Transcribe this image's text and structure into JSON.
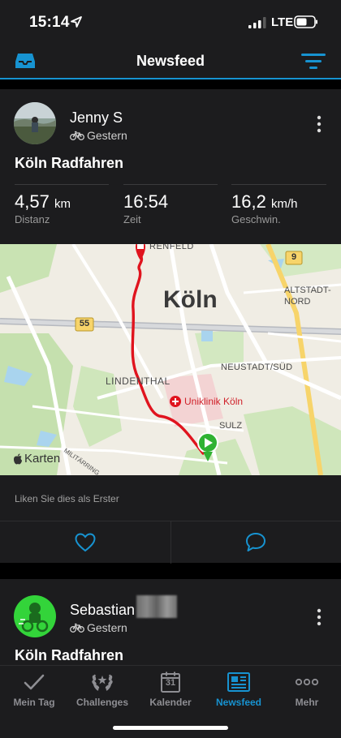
{
  "status": {
    "time": "15:14",
    "network": "LTE"
  },
  "header": {
    "title": "Newsfeed"
  },
  "posts": [
    {
      "user": "Jenny S",
      "when": "Gestern",
      "title": "Köln Radfahren",
      "stats": [
        {
          "value": "4,57",
          "unit": "km",
          "label": "Distanz"
        },
        {
          "value": "16:54",
          "unit": "",
          "label": "Zeit"
        },
        {
          "value": "16,2",
          "unit": "km/h",
          "label": "Geschwin."
        }
      ],
      "map": {
        "city": "Köln",
        "labels": [
          "RENFELD",
          "ALTSTADT-NORD",
          "NEUSTADT/SÜD",
          "LINDENTHAL",
          "SULZ",
          "Uniklinik Köln",
          "MILITÄRRING"
        ],
        "road_signs": [
          "9",
          "55"
        ],
        "attribution": "Karten"
      },
      "likes_text": "Liken Sie dies als Erster"
    },
    {
      "user": "Sebastian",
      "when": "Gestern",
      "title": "Köln Radfahren"
    }
  ],
  "tabs": [
    {
      "label": "Mein Tag",
      "icon": "checkmark-icon"
    },
    {
      "label": "Challenges",
      "icon": "laurel-icon"
    },
    {
      "label": "Kalender",
      "icon": "calendar-icon",
      "day": "31"
    },
    {
      "label": "Newsfeed",
      "icon": "newspaper-icon",
      "active": true
    },
    {
      "label": "Mehr",
      "icon": "more-dots-icon"
    }
  ],
  "colors": {
    "accent": "#1793d1",
    "route": "#e0141e",
    "start": "#2fb232"
  }
}
